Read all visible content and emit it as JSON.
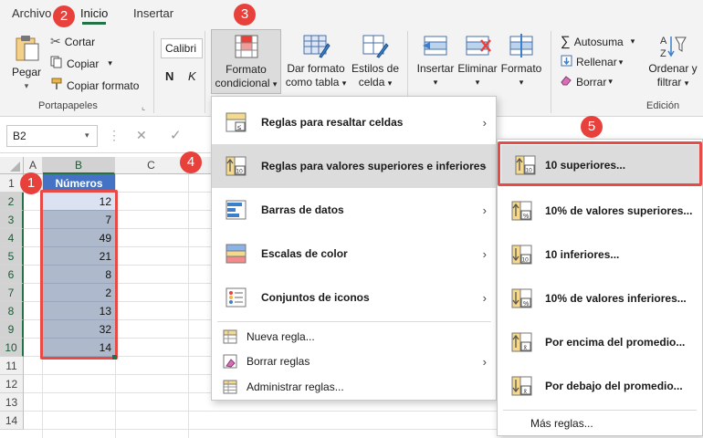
{
  "tabs": {
    "archivo": "Archivo",
    "inicio": "Inicio",
    "insertar": "Insertar"
  },
  "clipboard": {
    "paste": "Pegar",
    "cut": "Cortar",
    "copy": "Copiar",
    "format_painter": "Copiar formato",
    "group_label": "Portapapeles"
  },
  "font": {
    "name": "Calibri",
    "bold": "N",
    "italic": "K"
  },
  "styles": {
    "conditional_line1": "Formato",
    "conditional_line2": "condicional",
    "table_line1": "Dar formato",
    "table_line2": "como tabla",
    "cell_line1": "Estilos de",
    "cell_line2": "celda"
  },
  "cells_group": {
    "insert": "Insertar",
    "delete": "Eliminar",
    "format": "Formato"
  },
  "editing": {
    "autosum": "Autosuma",
    "fill": "Rellenar",
    "clear": "Borrar",
    "sort_line1": "Ordenar y",
    "sort_line2": "filtrar",
    "group_label": "Edición"
  },
  "formula_bar": {
    "name_box": "B2"
  },
  "columns": [
    "A",
    "B",
    "C"
  ],
  "rows": [
    "1",
    "2",
    "3",
    "4",
    "5",
    "6",
    "7",
    "8",
    "9",
    "10",
    "11",
    "12",
    "13",
    "14"
  ],
  "table": {
    "header": "Números",
    "values": [
      "12",
      "7",
      "49",
      "21",
      "8",
      "2",
      "13",
      "32",
      "14"
    ]
  },
  "cf_menu": {
    "items": [
      {
        "label": "Reglas para resaltar celdas",
        "icon": "highlight-rules-icon"
      },
      {
        "label": "Reglas para valores superiores e inferiores",
        "icon": "top-bottom-rules-icon"
      },
      {
        "label": "Barras de datos",
        "icon": "data-bars-icon"
      },
      {
        "label": "Escalas de color",
        "icon": "color-scales-icon"
      },
      {
        "label": "Conjuntos de iconos",
        "icon": "icon-sets-icon"
      }
    ],
    "commands": [
      "Nueva regla...",
      "Borrar reglas",
      "Administrar reglas..."
    ]
  },
  "submenu": {
    "items": [
      "10 superiores...",
      "10% de valores superiores...",
      "10 inferiores...",
      "10% de valores inferiores...",
      "Por encima del promedio...",
      "Por debajo del promedio..."
    ],
    "more": "Más reglas..."
  },
  "badges": [
    "1",
    "2",
    "3",
    "4",
    "5"
  ],
  "colors": {
    "accent": "#217346",
    "badge": "#e8413c",
    "table_header": "#4472c4",
    "selection": "#aeb9cc"
  }
}
